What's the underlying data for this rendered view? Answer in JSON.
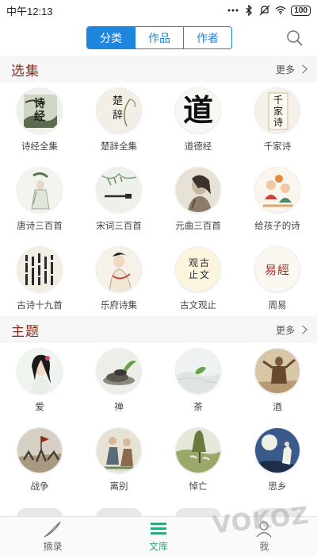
{
  "status_bar": {
    "time": "中午12:13",
    "battery": "100"
  },
  "nav": {
    "segments": [
      {
        "label": "分类",
        "active": true
      },
      {
        "label": "作品",
        "active": false
      },
      {
        "label": "作者",
        "active": false
      }
    ],
    "accent_color": "#1f86e0"
  },
  "sections": [
    {
      "title": "选集",
      "more": "更多",
      "items": [
        {
          "label": "诗经全集",
          "icon": "shijing-cover"
        },
        {
          "label": "楚辞全集",
          "icon": "chuci-cover"
        },
        {
          "label": "道德经",
          "icon": "daodejing-cover"
        },
        {
          "label": "千家诗",
          "icon": "qianjiashi-cover"
        },
        {
          "label": "唐诗三百首",
          "icon": "tang-poems-cover"
        },
        {
          "label": "宋词三百首",
          "icon": "song-ci-cover"
        },
        {
          "label": "元曲三百首",
          "icon": "yuan-qu-cover"
        },
        {
          "label": "给孩子的诗",
          "icon": "kids-poems-cover"
        },
        {
          "label": "古诗十九首",
          "icon": "nineteen-poems-cover"
        },
        {
          "label": "乐府诗集",
          "icon": "yuefu-cover"
        },
        {
          "label": "古文观止",
          "icon": "guwen-cover"
        },
        {
          "label": "周易",
          "icon": "zhouyi-cover"
        }
      ],
      "cover_text": {
        "shijing": "诗经",
        "chuci": "楚辞",
        "dao": "道",
        "qianjia": "千家诗",
        "guwen": "观古止文",
        "zhouyi": "易經"
      }
    },
    {
      "title": "主题",
      "more": "更多",
      "items": [
        {
          "label": "爱",
          "icon": "love-cover"
        },
        {
          "label": "禅",
          "icon": "zen-cover"
        },
        {
          "label": "茶",
          "icon": "tea-cover"
        },
        {
          "label": "酒",
          "icon": "wine-cover"
        },
        {
          "label": "战争",
          "icon": "war-cover"
        },
        {
          "label": "离别",
          "icon": "farewell-cover"
        },
        {
          "label": "悼亡",
          "icon": "mourning-cover"
        },
        {
          "label": "思乡",
          "icon": "homesick-cover"
        }
      ]
    }
  ],
  "tabbar": [
    {
      "label": "摘录",
      "icon": "quill-icon",
      "active": false
    },
    {
      "label": "文库",
      "icon": "library-icon",
      "active": true
    },
    {
      "label": "我",
      "icon": "profile-icon",
      "active": false
    }
  ],
  "tab_active_color": "#2fa97e",
  "watermark": "VOKOZ"
}
